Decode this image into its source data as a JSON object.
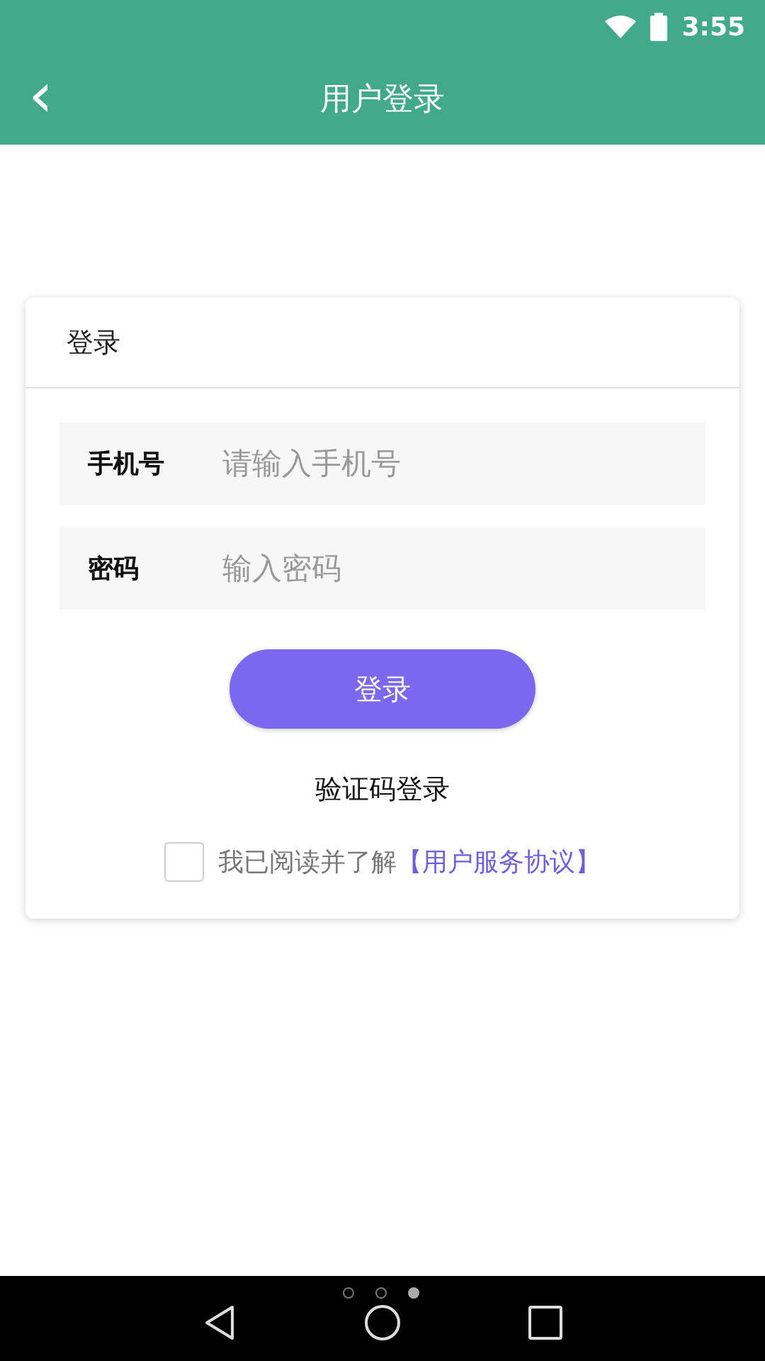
{
  "status_bar": {
    "time": "3:55"
  },
  "header": {
    "back": "‹",
    "title": "用户登录"
  },
  "card": {
    "title": "登录",
    "fields": [
      {
        "label": "手机号",
        "placeholder": "请输入手机号"
      },
      {
        "label": "密码",
        "placeholder": "输入密码"
      }
    ],
    "submit": "登录",
    "alt_login": "验证码登录",
    "agreement": {
      "checked": false,
      "text": "我已阅读并了解",
      "link": "【用户服务协议】"
    }
  },
  "nav_bar": {
    "dots": [
      {
        "selected": false
      },
      {
        "selected": false
      },
      {
        "selected": true
      }
    ]
  }
}
